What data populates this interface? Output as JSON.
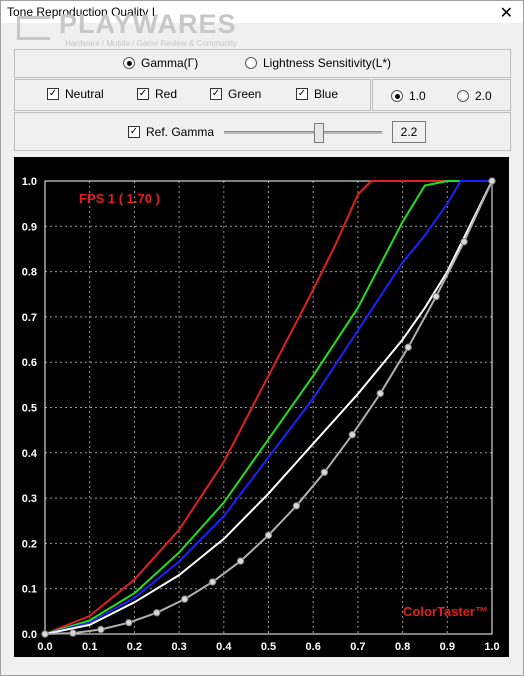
{
  "window": {
    "title": "Tone Reproduction Quality I"
  },
  "watermark": {
    "brand": "PLAYWARES",
    "tagline": "Hardware / Mobile / Game Review & Community"
  },
  "mode": {
    "options": [
      "Gamma(Γ)",
      "Lightness Sensitivity(L*)"
    ],
    "selected": "Gamma(Γ)"
  },
  "channels": [
    {
      "label": "Neutral",
      "checked": true
    },
    {
      "label": "Red",
      "checked": true
    },
    {
      "label": "Green",
      "checked": true
    },
    {
      "label": "Blue",
      "checked": true
    }
  ],
  "scale": {
    "options": [
      "1.0",
      "2.0"
    ],
    "selected": "1.0"
  },
  "ref_gamma": {
    "label": "Ref. Gamma",
    "checked": true,
    "value": "2.2",
    "slider_fraction": 0.6
  },
  "chart_data": {
    "type": "line",
    "title": "FPS 1 ( 1.70 )",
    "badge": "ColorTaster™",
    "xlim": [
      0,
      1
    ],
    "ylim": [
      0,
      1
    ],
    "x_ticks": [
      "0.0",
      "0.1",
      "0.2",
      "0.3",
      "0.4",
      "0.5",
      "0.6",
      "0.7",
      "0.8",
      "0.9",
      "1.0"
    ],
    "y_ticks": [
      "0.0",
      "0.1",
      "0.2",
      "0.3",
      "0.4",
      "0.5",
      "0.6",
      "0.7",
      "0.8",
      "0.9",
      "1.0"
    ],
    "grid": true,
    "series": [
      {
        "color": "#e02020",
        "x": [
          0,
          0.1,
          0.2,
          0.3,
          0.4,
          0.5,
          0.6,
          0.65,
          0.7,
          0.73,
          0.76,
          1.0
        ],
        "y": [
          0,
          0.04,
          0.12,
          0.23,
          0.38,
          0.57,
          0.76,
          0.86,
          0.97,
          1.0,
          1.0,
          1.0
        ]
      },
      {
        "color": "#20e020",
        "x": [
          0,
          0.1,
          0.2,
          0.3,
          0.4,
          0.5,
          0.6,
          0.7,
          0.8,
          0.85,
          0.9,
          1.0
        ],
        "y": [
          0,
          0.03,
          0.09,
          0.18,
          0.29,
          0.43,
          0.57,
          0.72,
          0.91,
          0.99,
          1.0,
          1.0
        ]
      },
      {
        "color": "#2020ff",
        "x": [
          0,
          0.1,
          0.2,
          0.3,
          0.4,
          0.5,
          0.6,
          0.7,
          0.8,
          0.85,
          0.9,
          0.93,
          1.0
        ],
        "y": [
          0,
          0.025,
          0.08,
          0.16,
          0.26,
          0.39,
          0.52,
          0.67,
          0.82,
          0.88,
          0.95,
          1.0,
          1.0
        ]
      },
      {
        "color": "#ffffff",
        "x": [
          0,
          0.1,
          0.2,
          0.3,
          0.4,
          0.5,
          0.6,
          0.7,
          0.8,
          0.85,
          0.9,
          0.95,
          1.0
        ],
        "y": [
          0,
          0.02,
          0.07,
          0.13,
          0.21,
          0.31,
          0.42,
          0.53,
          0.65,
          0.72,
          0.8,
          0.9,
          1.0
        ]
      },
      {
        "color": "#b0b0b0",
        "markers": true,
        "x": [
          0,
          0.0625,
          0.125,
          0.1875,
          0.25,
          0.3125,
          0.375,
          0.4375,
          0.5,
          0.5625,
          0.625,
          0.6875,
          0.75,
          0.8125,
          0.875,
          0.9375,
          1.0
        ],
        "y": [
          0,
          0.002,
          0.01,
          0.025,
          0.047,
          0.077,
          0.115,
          0.161,
          0.218,
          0.283,
          0.357,
          0.44,
          0.531,
          0.633,
          0.745,
          0.866,
          1.0
        ]
      }
    ]
  }
}
